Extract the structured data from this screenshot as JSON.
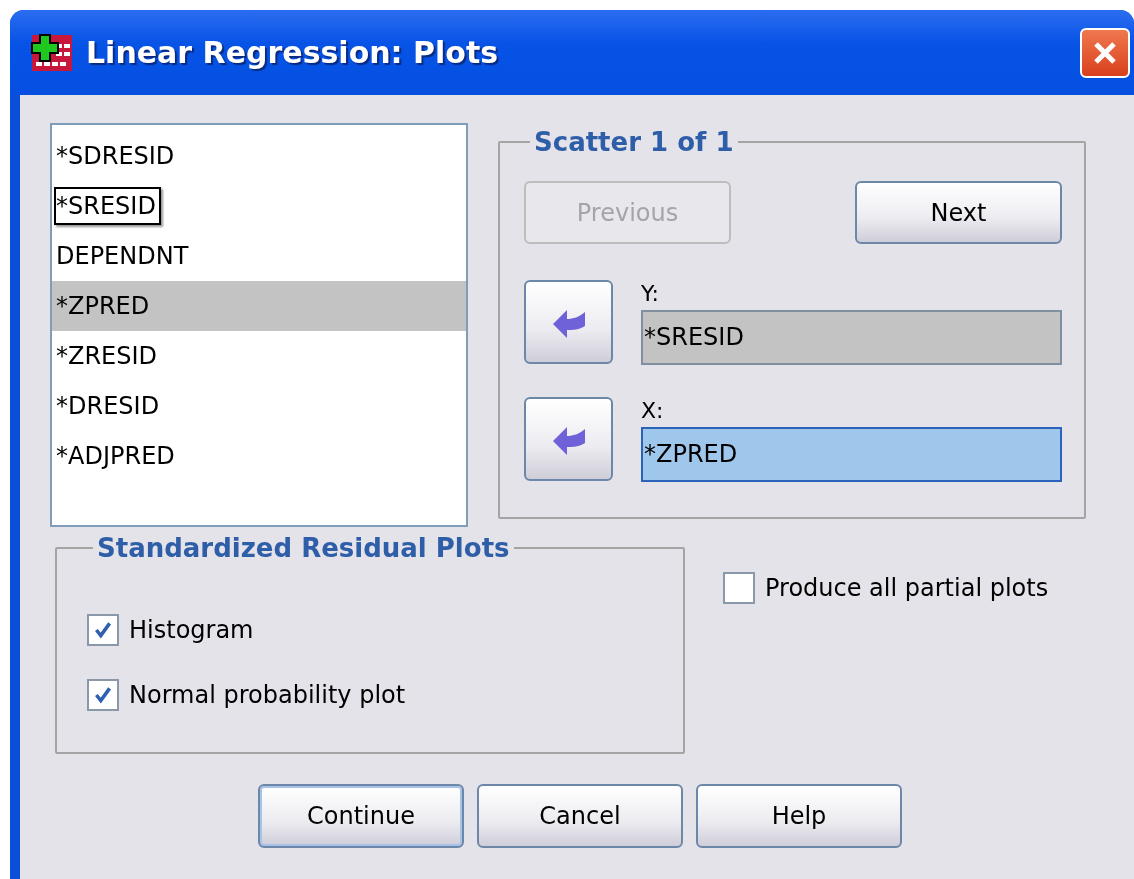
{
  "window": {
    "title": "Linear Regression: Plots"
  },
  "variables": [
    {
      "name": "*SDRESID",
      "selected": false,
      "focused": false
    },
    {
      "name": "*SRESID",
      "selected": false,
      "focused": true
    },
    {
      "name": "DEPENDNT",
      "selected": false,
      "focused": false
    },
    {
      "name": "*ZPRED",
      "selected": true,
      "focused": false
    },
    {
      "name": "*ZRESID",
      "selected": false,
      "focused": false
    },
    {
      "name": "*DRESID",
      "selected": false,
      "focused": false
    },
    {
      "name": "*ADJPRED",
      "selected": false,
      "focused": false
    }
  ],
  "scatter": {
    "title": "Scatter 1 of 1",
    "buttons": [
      {
        "label": "Previous",
        "disabled": true
      },
      {
        "label": "Next",
        "disabled": false
      }
    ],
    "fields": [
      {
        "label": "Y:",
        "value": "*SRESID",
        "active": false
      },
      {
        "label": "X:",
        "value": "*ZPRED",
        "active": true
      }
    ]
  },
  "residual_plots": {
    "title": "Standardized Residual Plots",
    "options": [
      {
        "label": "Histogram",
        "checked": true
      },
      {
        "label": "Normal probability plot",
        "checked": true
      }
    ]
  },
  "partial_plots": {
    "label": "Produce all partial plots",
    "checked": false
  },
  "buttons": [
    {
      "label": "Continue",
      "default": true
    },
    {
      "label": "Cancel",
      "default": false
    },
    {
      "label": "Help",
      "default": false
    }
  ]
}
